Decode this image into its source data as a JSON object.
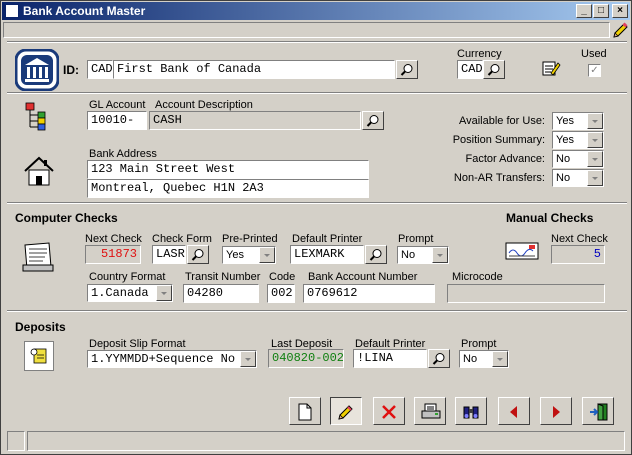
{
  "window": {
    "title": "Bank Account Master"
  },
  "header": {
    "id_label": "ID:",
    "currency_code": "CAD",
    "bank_name": "First Bank of Canada",
    "currency_label": "Currency",
    "currency_value": "CAD",
    "used_label": "Used"
  },
  "gl": {
    "account_label": "GL Account",
    "account_value": "10010-",
    "desc_label": "Account Description",
    "desc_value": "CASH"
  },
  "address": {
    "label": "Bank Address",
    "line1": "123 Main Street West",
    "line2": "Montreal, Quebec  H1N 2A3"
  },
  "options": [
    {
      "label": "Available for Use:",
      "value": "Yes"
    },
    {
      "label": "Position Summary:",
      "value": "Yes"
    },
    {
      "label": "Factor Advance:",
      "value": "No"
    },
    {
      "label": "Non-AR Transfers:",
      "value": "No"
    }
  ],
  "computer_checks": {
    "title": "Computer Checks",
    "next_check_label": "Next Check",
    "next_check_value": "51873",
    "check_form_label": "Check Form",
    "check_form_value": "LASR",
    "preprinted_label": "Pre-Printed",
    "preprinted_value": "Yes",
    "printer_label": "Default Printer",
    "printer_value": "LEXMARK",
    "prompt_label": "Prompt",
    "prompt_value": "No",
    "country_label": "Country Format",
    "country_value": "1.Canada",
    "transit_label": "Transit Number",
    "transit_value": "04280",
    "code_label": "Code",
    "code_value": "002",
    "account_label": "Bank Account Number",
    "account_value": "0769612",
    "micro_label": "Microcode",
    "micro_value": ""
  },
  "manual_checks": {
    "title": "Manual Checks",
    "next_check_label": "Next Check",
    "next_check_value": "5"
  },
  "deposits": {
    "title": "Deposits",
    "slip_label": "Deposit Slip Format",
    "slip_value": "1.YYMMDD+Sequence No",
    "last_label": "Last Deposit",
    "last_value": "040820-002",
    "printer_label": "Default Printer",
    "printer_value": "!LINA",
    "prompt_label": "Prompt",
    "prompt_value": "No"
  },
  "toolbar_icons": [
    "new-icon",
    "edit-icon",
    "delete-icon",
    "print-icon",
    "search-icon",
    "previous-icon",
    "next-icon",
    "exit-icon"
  ],
  "colors": {
    "next_check_red": "#e01010",
    "last_deposit_green": "#108010",
    "manual_next_blue": "#0000c0",
    "title_start": "#0a246a",
    "title_end": "#a6caf0"
  }
}
